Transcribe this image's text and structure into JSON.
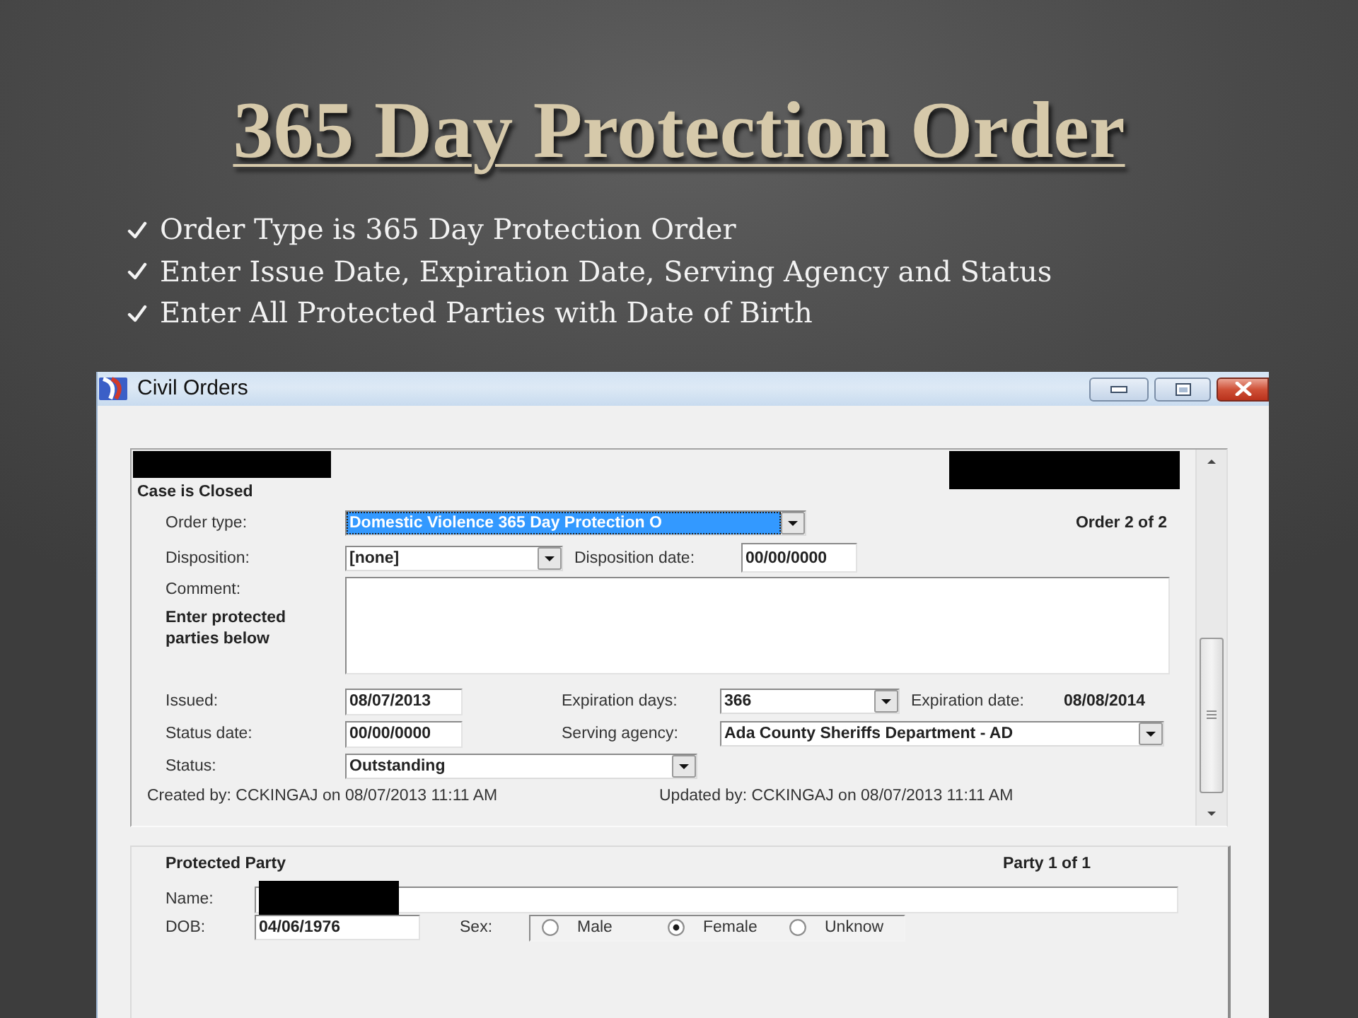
{
  "slide": {
    "title": "365 Day Protection Order",
    "bullets": [
      "Order Type is 365 Day Protection Order",
      "Enter Issue Date, Expiration Date, Serving Agency and Status",
      "Enter All Protected Parties with Date of Birth"
    ]
  },
  "window": {
    "title": "Civil Orders"
  },
  "order_panel": {
    "case_status": "Case is Closed",
    "order_count": "Order 2 of 2",
    "order_type": {
      "label": "Order type:",
      "value": "Domestic Violence 365 Day Protection O",
      "highlighted": true
    },
    "disposition": {
      "label": "Disposition:",
      "value": "[none]"
    },
    "disposition_date": {
      "label": "Disposition date:",
      "value": "00/00/0000"
    },
    "comment": {
      "label": "Comment:"
    },
    "protected_hint": "Enter protected parties below",
    "issued": {
      "label": "Issued:",
      "value": "08/07/2013"
    },
    "expiration_days": {
      "label": "Expiration days:",
      "value": "366"
    },
    "expiration_date": {
      "label": "Expiration date:",
      "value": "08/08/2014"
    },
    "status_date": {
      "label": "Status date:",
      "value": "00/00/0000"
    },
    "serving_agency": {
      "label": "Serving agency:",
      "value": "Ada County Sheriffs Department - AD"
    },
    "status": {
      "label": "Status:",
      "value": "Outstanding"
    },
    "created": "Created by: CCKINGAJ on 08/07/2013 11:11 AM",
    "updated": "Updated by: CCKINGAJ on 08/07/2013 11:11 AM"
  },
  "party_panel": {
    "title": "Protected Party",
    "party_count": "Party 1 of 1",
    "name": {
      "label": "Name:"
    },
    "dob": {
      "label": "DOB:",
      "value": "04/06/1976"
    },
    "sex": {
      "label": "Sex:",
      "options": [
        {
          "label": "Male",
          "selected": false
        },
        {
          "label": "Female",
          "selected": true
        },
        {
          "label": "Unknow",
          "selected": false
        }
      ]
    }
  }
}
